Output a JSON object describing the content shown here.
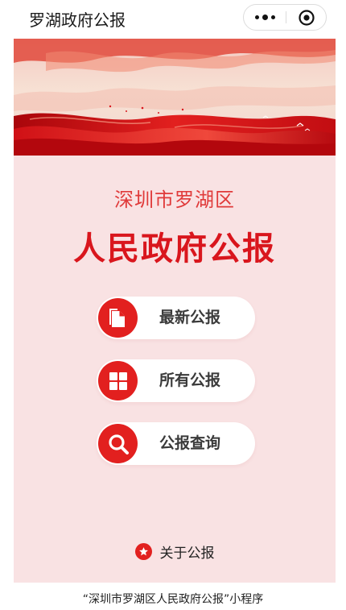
{
  "app": {
    "title": "罗湖政府公报"
  },
  "capsule": {
    "more_icon": "more-dots-icon",
    "close_icon": "target-close-icon"
  },
  "hero": {
    "subtitle": "深圳市罗湖区",
    "title": "人民政府公报"
  },
  "menu": [
    {
      "label": "最新公报",
      "icon": "document-icon"
    },
    {
      "label": "所有公报",
      "icon": "grid-icon"
    },
    {
      "label": "公报查询",
      "icon": "search-icon"
    }
  ],
  "about": {
    "label": "关于公报",
    "icon": "star-icon"
  },
  "footer": {
    "text": "“深圳市罗湖区人民政府公报”小程序"
  },
  "colors": {
    "accent": "#e2201f",
    "title_red": "#d9161d",
    "card_bg": "#f9e2e3"
  }
}
